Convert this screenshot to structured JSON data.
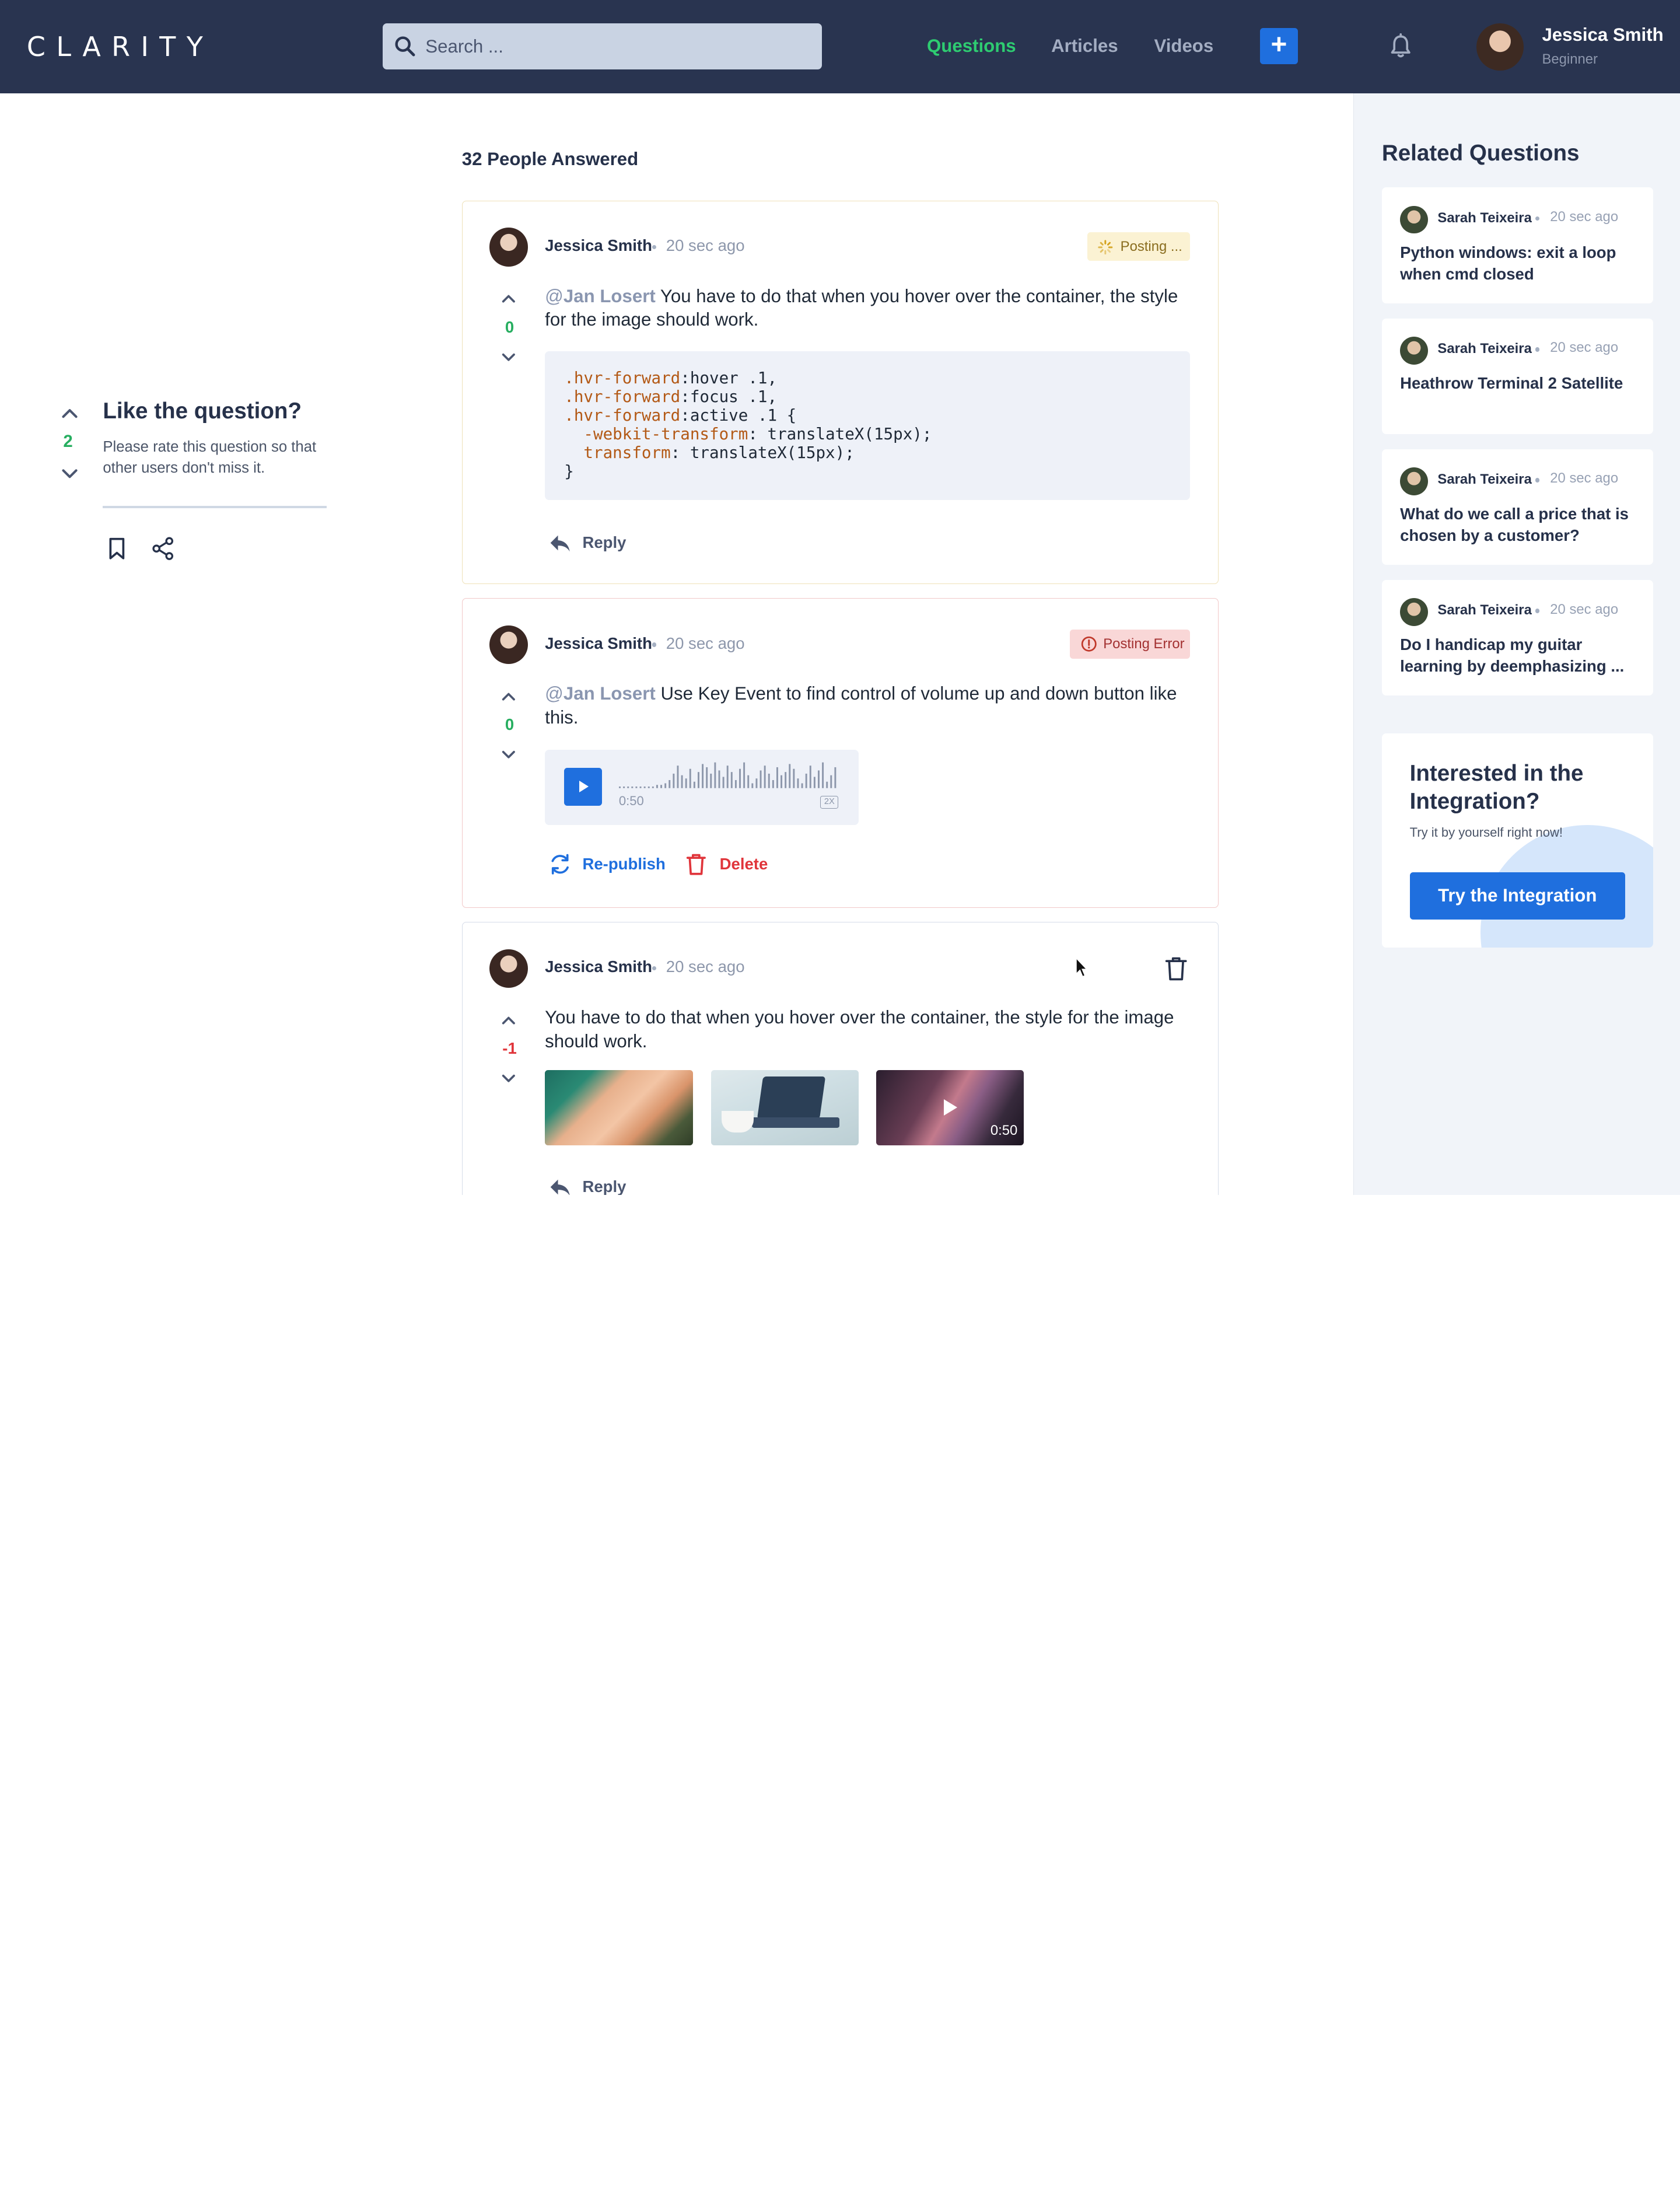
{
  "header": {
    "logo": "CLARITY",
    "search": {
      "placeholder": "Search ..."
    },
    "nav": [
      {
        "label": "Questions",
        "active": true
      },
      {
        "label": "Articles",
        "active": false
      },
      {
        "label": "Videos",
        "active": false
      }
    ],
    "add_button": "+",
    "user": {
      "name": "Jessica Smith",
      "level": "Beginner"
    }
  },
  "left_panel": {
    "vote_count": "2",
    "title": "Like the question?",
    "subtitle": "Please rate this question so that other users don't miss it."
  },
  "main": {
    "heading": "32 People Answered",
    "answers": [
      {
        "author": "Jessica Smith",
        "time": "20 sec ago",
        "status": "Posting ...",
        "votes": "0",
        "mention_at": "@",
        "mention": "Jan Losert",
        "text": " You have to do that when you hover over the container, the style for the image should work.",
        "code": [
          {
            "sel": ".hvr-forward",
            "rest": ":hover .1,"
          },
          {
            "sel": ".hvr-forward",
            "rest": ":focus .1,"
          },
          {
            "sel": ".hvr-forward",
            "rest": ":active .1 {"
          },
          {
            "sel": "  -webkit-transform",
            "rest": ": translateX(15px);"
          },
          {
            "sel": "  transform",
            "rest": ": translateX(15px);"
          },
          {
            "sel": "",
            "rest": "}"
          }
        ],
        "reply_label": "Reply"
      },
      {
        "author": "Jessica Smith",
        "time": "20 sec ago",
        "status": "Posting Error",
        "votes": "0",
        "mention_at": "@",
        "mention": "Jan Losert",
        "text": " Use Key Event to find control of volume up and down button like this.",
        "audio": {
          "duration": "0:50",
          "speed": "2X"
        },
        "republish_label": "Re-publish",
        "delete_label": "Delete"
      },
      {
        "author": "Jessica Smith",
        "time": "20 sec ago",
        "votes": "-1",
        "text": "You have to do that when you hover over the container, the style for the image should work.",
        "video_duration": "0:50",
        "reply_label": "Reply"
      }
    ]
  },
  "sidebar": {
    "title": "Related Questions",
    "questions": [
      {
        "author": "Sarah Teixeira",
        "time": "20 sec ago",
        "title": "Python windows: exit a loop when cmd closed"
      },
      {
        "author": "Sarah Teixeira",
        "time": "20 sec ago",
        "title": "Heathrow Terminal 2 Satellite"
      },
      {
        "author": "Sarah Teixeira",
        "time": "20 sec ago",
        "title": "What do we call a price that is chosen by a customer?"
      },
      {
        "author": "Sarah Teixeira",
        "time": "20 sec ago",
        "title": "Do I handicap my guitar learning by deemphasizing ..."
      }
    ],
    "promo": {
      "title": "Interested in the Integration?",
      "subtitle": "Try it by yourself right now!",
      "button": "Try the Integration"
    }
  },
  "colors": {
    "header_bg": "#293450",
    "accent": "#1f6fde",
    "active_nav": "#2ecc71",
    "vote_positive": "#27ae60",
    "vote_negative": "#e0353b",
    "error": "#e0353b"
  }
}
